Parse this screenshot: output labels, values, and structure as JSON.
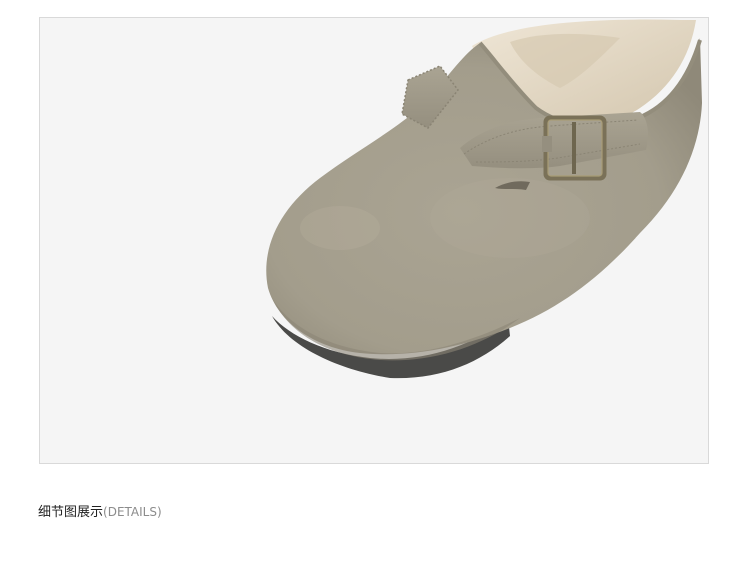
{
  "product_photo": {
    "subject": "suede-clog-with-buckle-strap-and-fleece-lining",
    "colors": {
      "suede": "#a49e8d",
      "suede_shadow": "#8c8676",
      "fleece": "#e2d7c4",
      "sole": "#4a4a48",
      "buckle": "#7a7158",
      "background": "#f5f5f5"
    }
  },
  "caption": {
    "title": "细节图展示",
    "subtitle": "(DETAILS)"
  }
}
